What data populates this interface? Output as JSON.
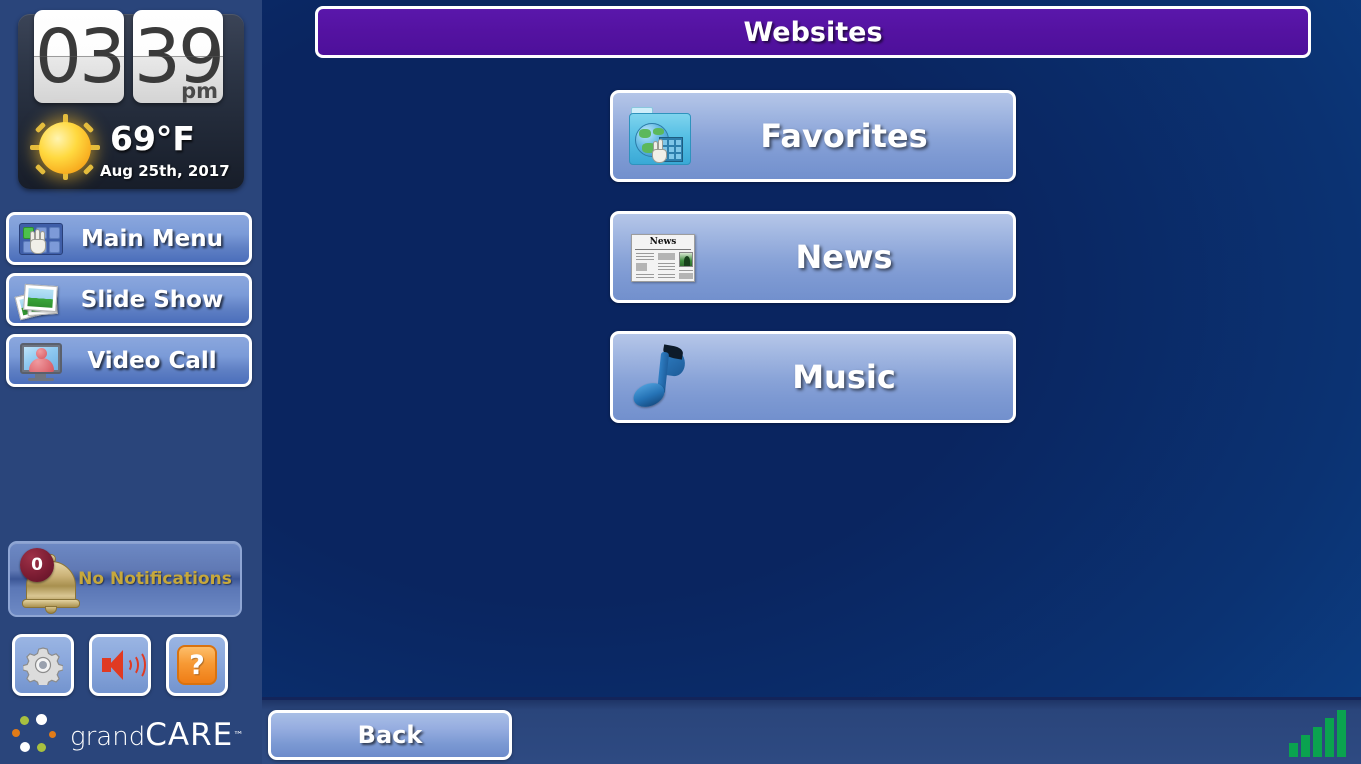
{
  "sidebar": {
    "clock": {
      "hours": "03",
      "minutes": "39",
      "meridiem": "pm",
      "temperature": "69°F",
      "date": "Aug 25th, 2017",
      "weather_icon": "sun-icon"
    },
    "nav_items": [
      {
        "label": "Main Menu",
        "icon": "grid-pointer-icon"
      },
      {
        "label": "Slide Show",
        "icon": "photos-icon"
      },
      {
        "label": "Video Call",
        "icon": "monitor-person-icon"
      }
    ],
    "notifications": {
      "count": "0",
      "label": "No Notifications",
      "icon": "bell-icon"
    },
    "tools": [
      {
        "name": "settings",
        "icon": "gear-icon",
        "label": ""
      },
      {
        "name": "volume",
        "icon": "speaker-icon",
        "label": ""
      },
      {
        "name": "help",
        "icon": "question-mark-icon",
        "label": "?"
      }
    ],
    "logo": {
      "text_light": "grand",
      "text_bold": "CARE",
      "trademark": "™"
    }
  },
  "main": {
    "header_title": "Websites",
    "buttons": [
      {
        "label": "Favorites",
        "icon": "folder-globe-icon"
      },
      {
        "label": "News",
        "icon": "newspaper-icon"
      },
      {
        "label": "Music",
        "icon": "music-note-icon"
      }
    ],
    "news_icon_masthead": "News"
  },
  "footer": {
    "back_label": "Back",
    "signal": {
      "icon": "signal-bars-icon",
      "bars": 5,
      "active": 5
    }
  },
  "colors": {
    "sidebar_bg": "#2a457b",
    "main_bg_dark": "#0a2560",
    "main_bg_light": "#0d4e9c",
    "header_purple": "#5412a1",
    "button_blue": "#8aa4d8",
    "notification_text": "#c6a83c",
    "badge_red": "#7c1d33",
    "help_orange": "#f79a35",
    "signal_green": "#0aa34f",
    "white": "#ffffff"
  }
}
